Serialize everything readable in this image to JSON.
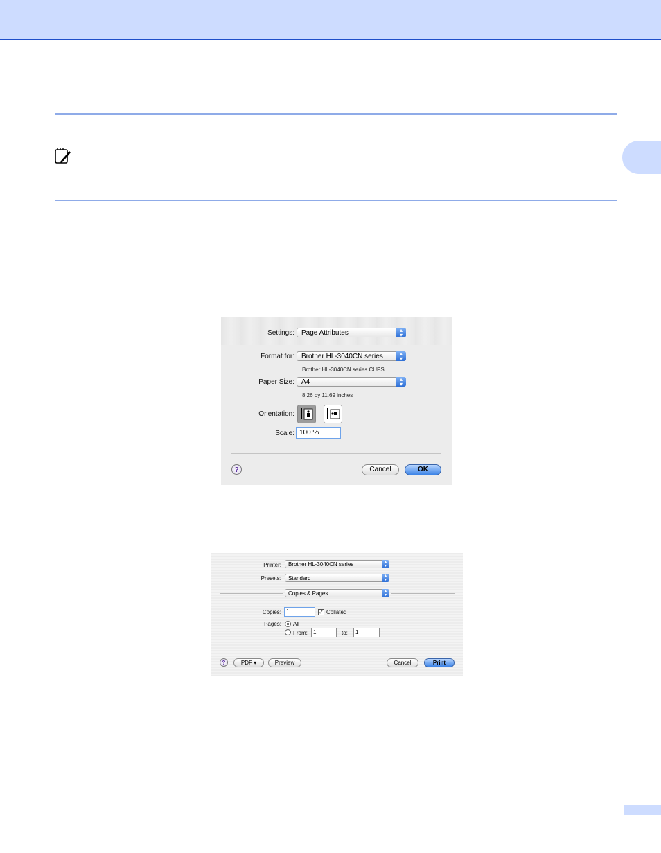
{
  "dialog_page_setup": {
    "settings_label": "Settings:",
    "settings_value": "Page Attributes",
    "format_for_label": "Format for:",
    "format_for_value": "Brother HL-3040CN series",
    "format_for_sub": "Brother HL-3040CN series CUPS",
    "paper_size_label": "Paper Size:",
    "paper_size_value": "A4",
    "paper_size_sub": "8.26 by 11.69 inches",
    "orientation_label": "Orientation:",
    "scale_label": "Scale:",
    "scale_value": "100 %",
    "help": "?",
    "cancel": "Cancel",
    "ok": "OK"
  },
  "dialog_print": {
    "printer_label": "Printer:",
    "printer_value": "Brother HL-3040CN series",
    "presets_label": "Presets:",
    "presets_value": "Standard",
    "panel_value": "Copies & Pages",
    "copies_label": "Copies:",
    "copies_value": "1",
    "collated_label": "Collated",
    "pages_label": "Pages:",
    "all_label": "All",
    "from_label": "From:",
    "from_value": "1",
    "to_label": "to:",
    "to_value": "1",
    "help": "?",
    "pdf": "PDF ▾",
    "preview": "Preview",
    "cancel": "Cancel",
    "print": "Print"
  }
}
